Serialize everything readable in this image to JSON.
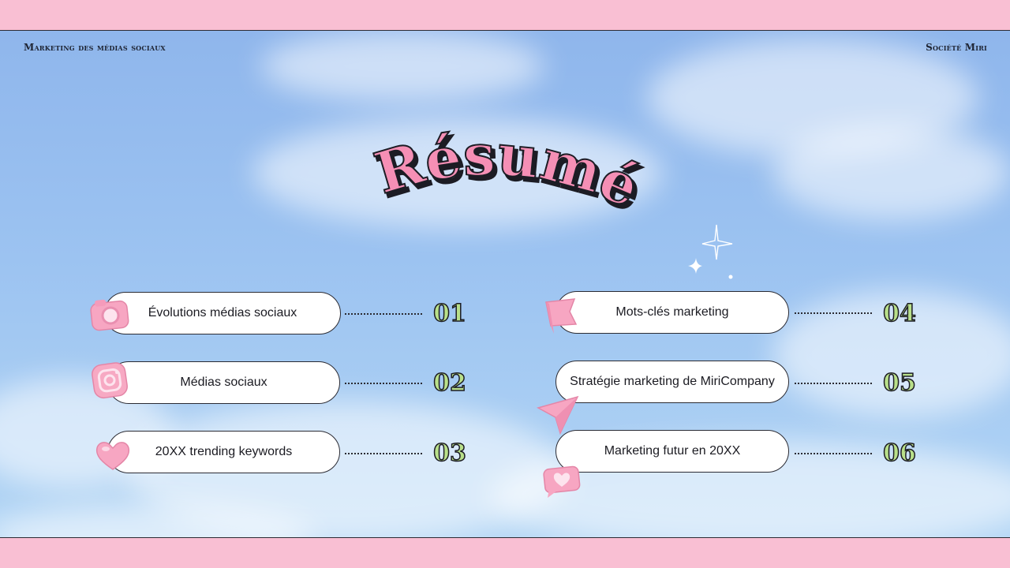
{
  "header": {
    "left": "Marketing des médias sociaux",
    "right": "Société Miri"
  },
  "title": "Résumé",
  "items": [
    {
      "label": "Évolutions médias sociaux",
      "number": "01",
      "icon": "camera-icon"
    },
    {
      "label": "Médias sociaux",
      "number": "02",
      "icon": "instagram-icon"
    },
    {
      "label": "20XX trending keywords",
      "number": "03",
      "icon": "heart-icon"
    },
    {
      "label": "Mots-clés marketing",
      "number": "04",
      "icon": "flag-icon"
    },
    {
      "label": "Stratégie marketing de MiriCompany",
      "number": "05",
      "icon": "paper-plane-icon"
    },
    {
      "label": "Marketing futur en 20XX",
      "number": "06",
      "icon": "heart-message-icon"
    }
  ],
  "colors": {
    "frame_pink": "#f9bfd3",
    "title_pink": "#f58fb5",
    "number_green": "#b9e08a",
    "sky_blue": "#9cc3f1"
  }
}
